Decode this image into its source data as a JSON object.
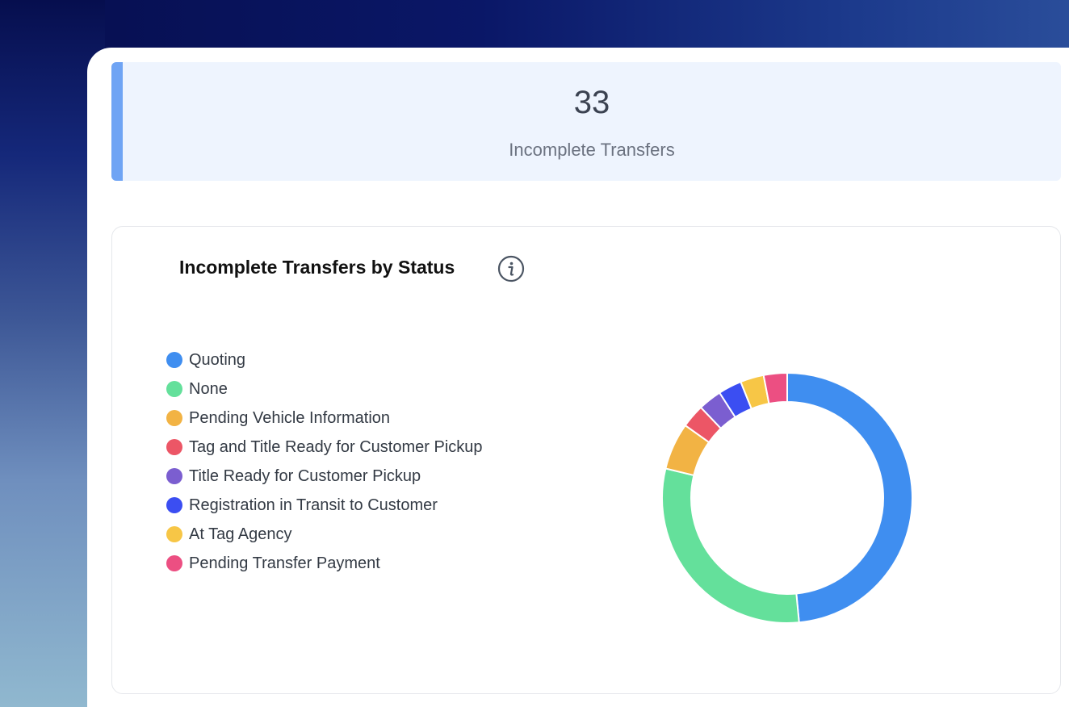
{
  "kpi": {
    "value": "33",
    "label": "Incomplete Transfers",
    "accent_color": "#6fa4f4"
  },
  "chart_card": {
    "title": "Incomplete Transfers by Status",
    "info_icon": "info-icon"
  },
  "chart_data": {
    "type": "pie",
    "title": "Incomplete Transfers by Status",
    "legend_position": "left",
    "categories": [
      "Quoting",
      "None",
      "Pending Vehicle Information",
      "Tag and Title Ready for Customer Pickup",
      "Title Ready for Customer Pickup",
      "Registration in Transit to Customer",
      "At Tag Agency",
      "Pending Transfer Payment"
    ],
    "values": [
      16,
      10,
      2,
      1,
      1,
      1,
      1,
      1
    ],
    "colors": [
      "#3f8ef0",
      "#64e09b",
      "#f2b344",
      "#ec5666",
      "#7b5ed0",
      "#3b4ef2",
      "#f7c646",
      "#ec4f82"
    ]
  }
}
